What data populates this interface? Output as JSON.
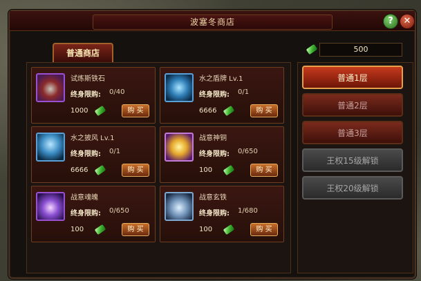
{
  "window": {
    "title": "波塞冬商店"
  },
  "tabs": [
    {
      "label": "普通商店"
    }
  ],
  "currency": {
    "amount": "500",
    "icon": "green-gem-icon"
  },
  "common": {
    "limit_label": "终身限购:",
    "buy_label": "购 买"
  },
  "items": [
    {
      "name": "试炼斯铁石",
      "limit": "0/40",
      "price": "1000",
      "icon": "forge-stone-icon"
    },
    {
      "name": "水之盾牌 Lv.1",
      "limit": "0/1",
      "price": "6666",
      "icon": "water-shield-icon"
    },
    {
      "name": "水之披风 Lv.1",
      "limit": "0/1",
      "price": "6666",
      "icon": "water-cloak-icon"
    },
    {
      "name": "战意神铜",
      "limit": "0/650",
      "price": "100",
      "icon": "gold-ingot-icon"
    },
    {
      "name": "战意魂魄",
      "limit": "0/650",
      "price": "100",
      "icon": "soul-crystal-icon"
    },
    {
      "name": "战意玄铁",
      "limit": "1/680",
      "price": "100",
      "icon": "iron-ingot-icon"
    }
  ],
  "floors": [
    {
      "label": "普通1层",
      "state": "active"
    },
    {
      "label": "普通2层",
      "state": "normal"
    },
    {
      "label": "普通3层",
      "state": "normal"
    },
    {
      "label": "王权15级解锁",
      "state": "locked"
    },
    {
      "label": "王权20级解锁",
      "state": "locked"
    }
  ]
}
